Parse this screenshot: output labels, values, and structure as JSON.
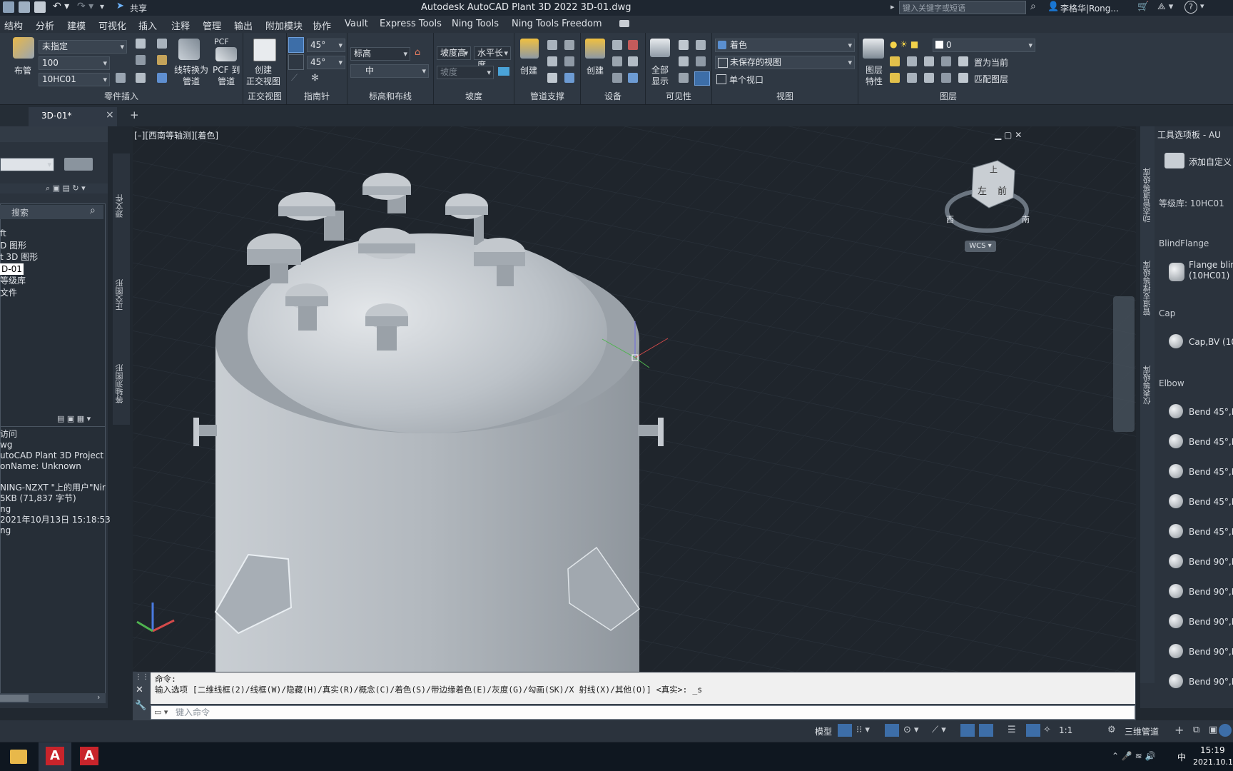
{
  "app": {
    "title": "Autodesk AutoCAD Plant 3D 2022    3D-01.dwg",
    "share_label": "共享",
    "search_placeholder": "键入关键字或短语",
    "user": "李格华|Rong...",
    "help": "?"
  },
  "menu": [
    "结构",
    "分析",
    "建模",
    "可视化",
    "插入",
    "注释",
    "管理",
    "输出",
    "附加模块",
    "协作",
    "Vault",
    "Express Tools",
    "Ning Tools",
    "Ning Tools Freedom"
  ],
  "ribbon": {
    "part_insert": {
      "title": "零件插入",
      "route_label": "布管",
      "spec_dd": "未指定",
      "size_dd": "100",
      "class_dd": "10HC01",
      "convert_label": "线转换为\n管道",
      "pcf_top": "PCF",
      "pcf_label": "PCF 到\n管道"
    },
    "ortho": {
      "title": "正交视图",
      "create_label": "创建\n正交视图"
    },
    "compass": {
      "title": "指南针",
      "angle1": "45°",
      "angle2": "45°"
    },
    "elevation": {
      "title": "标高和布线",
      "elev_field": "标高",
      "justify_dd": "中"
    },
    "slope": {
      "title": "坡度",
      "slope_height": "坡度高",
      "horiz_len": "水平长度",
      "slope_field": "坡度"
    },
    "pipe_support": {
      "title": "管道支撑",
      "create_label": "创建"
    },
    "equipment": {
      "title": "设备",
      "create_label": "创建"
    },
    "visibility": {
      "title": "可见性",
      "show_all_label": "全部\n显示"
    },
    "view": {
      "title": "视图",
      "visual_style": "着色",
      "saved_view": "未保存的视图",
      "viewport_config": "单个视口"
    },
    "layers": {
      "title": "图层",
      "props_label": "图层\n特性",
      "layer_dd": "0",
      "set_current": "置为当前",
      "match_layer": "匹配图层"
    }
  },
  "tabs": {
    "doc": "3D-01*",
    "close": "×",
    "add": "+"
  },
  "left_panel": {
    "search_placeholder": "搜索",
    "tree": [
      "ft",
      "D 图形",
      "t 3D 图形",
      "D-01",
      "等级库",
      "文件"
    ],
    "selected_item": "D-01",
    "details": [
      "访问",
      "wg",
      "utoCAD Plant 3D Project",
      "onName: Unknown",
      "",
      "NING-NZXT \"上的用户\"Nir",
      "5KB (71,837 字节)",
      "ng",
      "2021年10月13日 15:18:53",
      "ng"
    ],
    "vtabs": [
      "源文件",
      "正交图形",
      "等轴测图形"
    ]
  },
  "viewport": {
    "label": "[–][西南等轴测][着色]",
    "viewcube_top": "上",
    "viewcube_left": "左",
    "viewcube_front": "前",
    "compass_w": "西",
    "compass_s": "南",
    "wcs": "WCS"
  },
  "right_panel": {
    "title": "工具选项板 - AU",
    "add_custom": "添加自定义",
    "spec": "等级库: 10HC01",
    "vtabs": [
      "动态管道等级库",
      "管道支撑等级库",
      "仪表等级库"
    ],
    "sections": [
      {
        "heading": "BlindFlange",
        "items": [
          "Flange blin\n(10HC01)"
        ]
      },
      {
        "heading": "Cap",
        "items": [
          "Cap,BV (10"
        ]
      },
      {
        "heading": "Elbow",
        "items": [
          "Bend 45°,B",
          "Bend 45°,B",
          "Bend 45°,B",
          "Bend 45°,B",
          "Bend 45°,B",
          "Bend 90°,B",
          "Bend 90°,B",
          "Bend 90°,B",
          "Bend 90°,B",
          "Bend 90°,B"
        ]
      }
    ]
  },
  "command": {
    "line1": "命令:",
    "line2": "输入选项 [二维线框(2)/线框(W)/隐藏(H)/真实(R)/概念(C)/着色(S)/带边缘着色(E)/灰度(G)/勾画(SK)/X 射线(X)/其他(O)] <真实>: _s",
    "placeholder": "键入命令"
  },
  "status": {
    "model": "模型",
    "scale": "1:1",
    "workspace": "三维管道"
  },
  "taskbar": {
    "time": "15:19",
    "date": "2021.10.1",
    "ime": "中"
  },
  "colors": {
    "accent": "#4a90d9",
    "x_axis": "#e04040",
    "y_axis": "#40c040",
    "z_axis": "#4070e0"
  }
}
